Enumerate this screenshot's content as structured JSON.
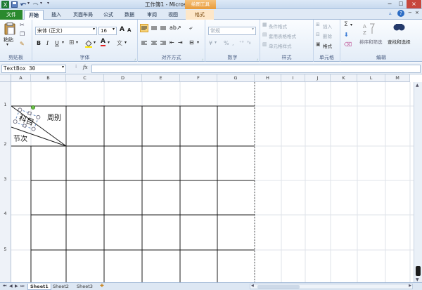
{
  "window_title": "工作簿1 - Microsoft Excel",
  "drawing_tools_label": "绘图工具",
  "tabs": [
    "文件",
    "开始",
    "插入",
    "页面布局",
    "公式",
    "数据",
    "审阅",
    "视图",
    "格式"
  ],
  "clipboard": {
    "paste": "粘贴",
    "group": "剪贴板"
  },
  "font": {
    "name": "宋体 (正文)",
    "size": "16",
    "group": "字体",
    "bold": "B",
    "italic": "I",
    "underline": "U",
    "grow": "A",
    "shrink": "A",
    "font_color": "A"
  },
  "alignment": {
    "group": "对齐方式"
  },
  "number": {
    "format": "常规",
    "group": "数字",
    "percent": "%",
    "comma": ","
  },
  "styles": {
    "cond": "条件格式",
    "table": "套用表格格式",
    "cell": "单元格样式",
    "group": "样式"
  },
  "cells": {
    "insert": "插入",
    "delete": "删除",
    "format": "格式",
    "group": "单元格"
  },
  "editing": {
    "sum": "Σ",
    "sort": "排序和筛选",
    "find": "查找和选择",
    "group": "编辑"
  },
  "namebox": "TextBox 30",
  "fx": "fx",
  "columns": [
    "A",
    "B",
    "C",
    "D",
    "E",
    "F",
    "G",
    "H",
    "I",
    "J",
    "K",
    "L",
    "M"
  ],
  "rows": [
    "1",
    "2",
    "3",
    "4",
    "5",
    "6"
  ],
  "cell_texts": {
    "zhoubie": "周别",
    "jieci": "节次",
    "kemu": "科目"
  },
  "sheet_tabs": [
    "Sheet1",
    "Sheet2",
    "Sheet3"
  ],
  "colors": {
    "accent": "#2b6cc4",
    "file_tab": "#2a8a2e",
    "drawing_tools": "#d9822b"
  }
}
